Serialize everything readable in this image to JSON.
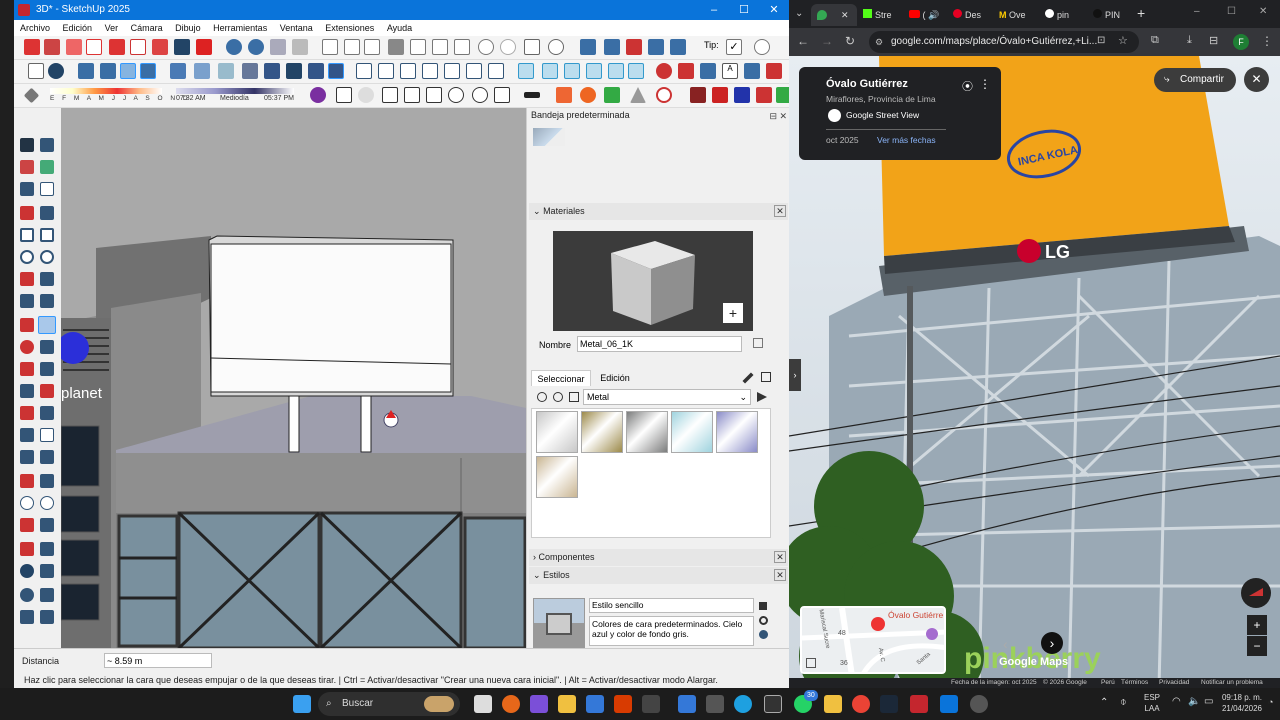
{
  "sketchup": {
    "title": "3D* - SketchUp 2025",
    "menu": [
      "Archivo",
      "Edición",
      "Ver",
      "Cámara",
      "Dibujo",
      "Herramientas",
      "Ventana",
      "Extensiones",
      "Ayuda"
    ],
    "shadow": {
      "months": "E F M A M J J A S O N D",
      "time_left": "07:32 AM",
      "midday": "Mediodía",
      "time_right": "05:37 PM"
    },
    "tips_label": "Tip:",
    "model_text": "planet",
    "tray": {
      "title": "Bandeja predeterminada",
      "materials": {
        "header": "Materiales",
        "name_label": "Nombre",
        "name_value": "Metal_06_1K",
        "tab_select": "Seleccionar",
        "tab_edit": "Edición",
        "library": "Metal",
        "swatches": [
          "#c7c7c7",
          "#9c8a4a",
          "#7c7d7d",
          "#9fd3de",
          "#8a8cc8",
          "#c9b592"
        ]
      },
      "components": "Componentes",
      "styles": {
        "header": "Estilos",
        "name": "Estilo sencillo",
        "description": "Colores de cara predeterminados. Cielo azul y color de fondo gris."
      }
    },
    "status": {
      "distance_label": "Distancia",
      "distance_value": "~ 8.59 m",
      "hint": "Haz clic para seleccionar la cara que deseas empujar o de la que deseas tirar. | Ctrl = Activar/desactivar \"Crear una nueva cara inicial\". | Alt = Activar/desactivar modo Alargar."
    }
  },
  "chrome": {
    "tabs": [
      "Stre",
      "Des",
      "Ove",
      "pin",
      "PIN"
    ],
    "url": "google.com/maps/place/Óvalo+Gutiérrez,+Li...",
    "profile": "F",
    "street_view": {
      "place": "Óvalo Gutiérrez",
      "region": "Miraflores, Provincia de Lima",
      "source": "Google Street View",
      "date": "oct 2025",
      "more_dates": "Ver más fechas",
      "share": "Compartir",
      "billboard_text": "INCA KOLA",
      "lg_text": "LG",
      "minimap_label": "Óvalo Gutiérre",
      "minimap_street1": "Mariscal Sucre",
      "minimap_street2": "Av. C",
      "minimap_num1": "48",
      "minimap_num2": "36",
      "minimap_street3": "Santa",
      "watermark": "Google Maps",
      "store_sign": "pinkberry",
      "footer": [
        "Fecha de la imagen: oct 2025",
        "© 2026 Google",
        "Perú",
        "Términos",
        "Privacidad",
        "Notificar un problema"
      ]
    }
  },
  "taskbar": {
    "search": "Buscar",
    "lang": "ESP",
    "lang2": "LAA",
    "time": "09:18 p. m.",
    "date": "21/04/2026",
    "badge": "30"
  }
}
